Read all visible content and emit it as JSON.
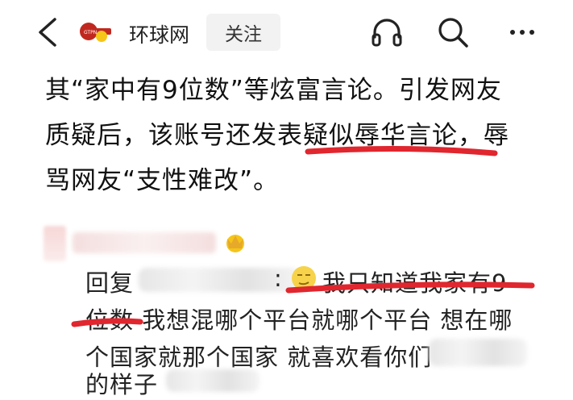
{
  "header": {
    "brand_name": "环球网",
    "follow_label": "关注",
    "icons": [
      "back-arrow-icon",
      "news-logo-icon",
      "headphones-icon",
      "search-icon",
      "more-icon"
    ]
  },
  "article": {
    "lines": [
      "其“家中有9位数”等炫富言论。引发网友",
      "质疑后，该账号还发表疑似辱华言论，辱",
      "骂网友“支性难改”。"
    ]
  },
  "reply": {
    "prefix": "回复",
    "colon": ":",
    "line1_text": "我只知道我家有9",
    "line2_text": "位数 我想混哪个平台就哪个平台 想在哪",
    "line3_text": "个国家就那个国家 就喜欢看你们",
    "line4_text": "的样子"
  },
  "colors": {
    "annotation_red": "#e0262e",
    "follow_bg": "#f2f2f2",
    "logo_red": "#c0281f",
    "logo_yellow": "#f5c518"
  }
}
